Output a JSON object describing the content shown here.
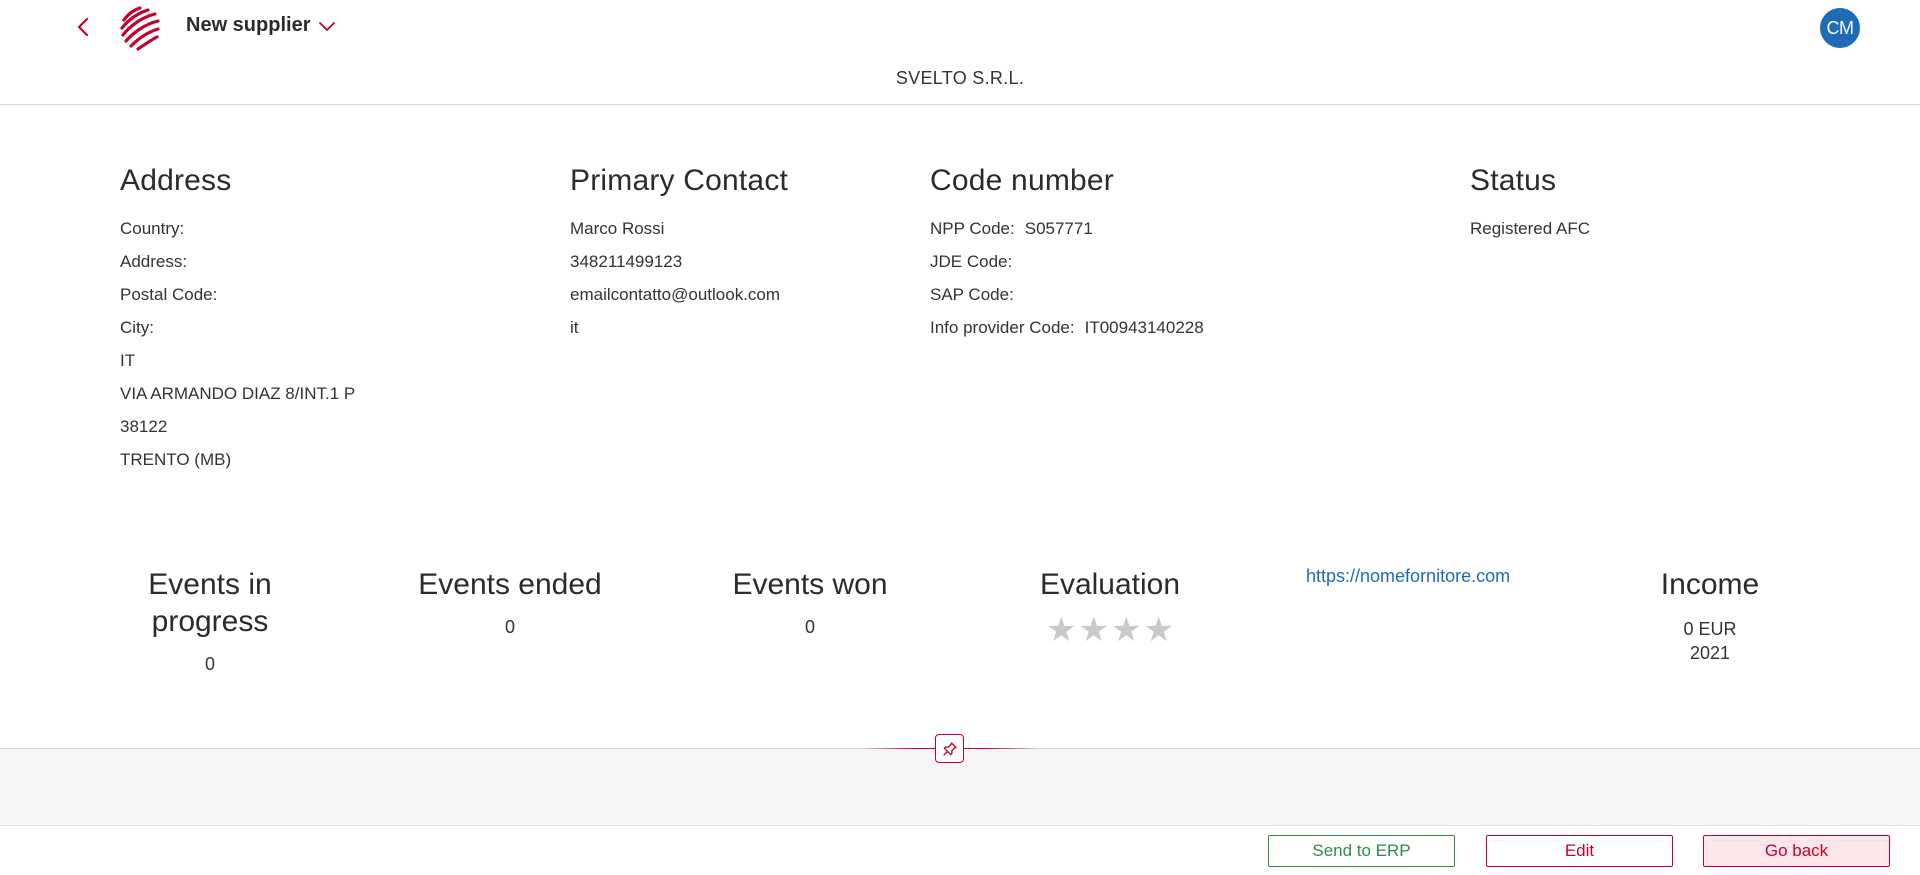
{
  "header": {
    "page_title": "New supplier",
    "avatar_initials": "CM",
    "company_name": "SVELTO S.R.L."
  },
  "address": {
    "title": "Address",
    "lines": [
      "Country:",
      "Address:",
      "Postal Code:",
      "City:",
      "IT",
      "VIA ARMANDO DIAZ 8/INT.1 P",
      "38122",
      "TRENTO (MB)"
    ]
  },
  "primary_contact": {
    "title": "Primary Contact",
    "name": "Marco Rossi",
    "phone": "348211499123",
    "email": "emailcontatto@outlook.com",
    "language": "it"
  },
  "code_number": {
    "title": "Code number",
    "rows": [
      {
        "label": "NPP Code:",
        "value": "S057771"
      },
      {
        "label": "JDE Code:",
        "value": ""
      },
      {
        "label": "SAP Code:",
        "value": ""
      },
      {
        "label": "Info provider Code:",
        "value": "IT00943140228"
      }
    ]
  },
  "status": {
    "title": "Status",
    "value": "Registered AFC"
  },
  "stats": {
    "in_progress": {
      "title": "Events in progress",
      "value": "0"
    },
    "ended": {
      "title": "Events ended",
      "value": "0"
    },
    "won": {
      "title": "Events won",
      "value": "0"
    },
    "evaluation": {
      "title": "Evaluation",
      "rating": 0,
      "max": 4
    },
    "website": "https://nomefornitore.com",
    "income": {
      "title": "Income",
      "amount": "0 EUR",
      "year": "2021"
    }
  },
  "footer": {
    "send_erp_label": "Send to ERP",
    "edit_label": "Edit",
    "go_back_label": "Go back"
  },
  "colors": {
    "brand_red": "#c4002e",
    "avatar_blue": "#1f6bb5",
    "success_green": "#2e8b4a",
    "star_empty": "#c9c9c9"
  }
}
